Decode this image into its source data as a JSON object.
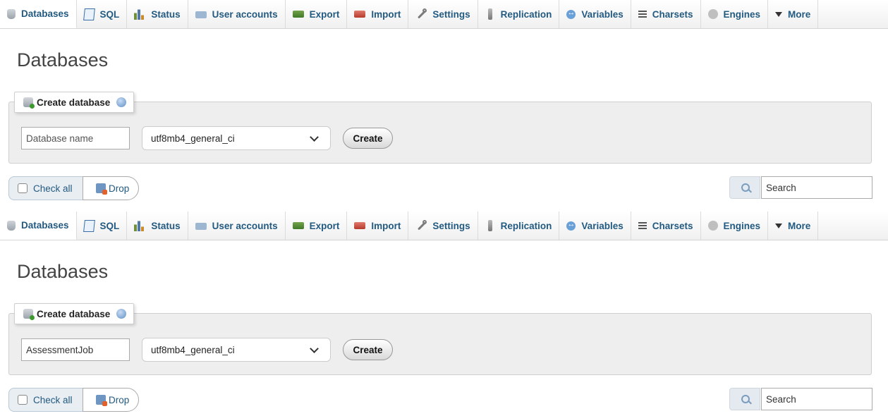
{
  "tabs": [
    {
      "label": "Databases",
      "icon": "database-icon"
    },
    {
      "label": "SQL",
      "icon": "sql-icon"
    },
    {
      "label": "Status",
      "icon": "status-chart-icon"
    },
    {
      "label": "User accounts",
      "icon": "user-accounts-icon"
    },
    {
      "label": "Export",
      "icon": "export-icon"
    },
    {
      "label": "Import",
      "icon": "import-icon"
    },
    {
      "label": "Settings",
      "icon": "wrench-icon"
    },
    {
      "label": "Replication",
      "icon": "replication-icon"
    },
    {
      "label": "Variables",
      "icon": "variables-icon"
    },
    {
      "label": "Charsets",
      "icon": "charsets-icon"
    },
    {
      "label": "Engines",
      "icon": "engines-icon"
    },
    {
      "label": "More",
      "icon": "triangle-down-icon"
    }
  ],
  "panels": [
    {
      "page_title": "Databases",
      "create": {
        "legend": "Create database",
        "db_name_value": "",
        "db_name_placeholder": "Database name",
        "collation": "utf8mb4_general_ci",
        "create_label": "Create"
      },
      "bulk": {
        "check_all_label": "Check all",
        "drop_label": "Drop"
      },
      "search": {
        "placeholder": "Search"
      }
    },
    {
      "page_title": "Databases",
      "create": {
        "legend": "Create database",
        "db_name_value": "AssessmentJob",
        "db_name_placeholder": "Database name",
        "collation": "utf8mb4_general_ci",
        "create_label": "Create"
      },
      "bulk": {
        "check_all_label": "Check all",
        "drop_label": "Drop"
      },
      "search": {
        "placeholder": "Search"
      }
    }
  ],
  "colors": {
    "link": "#235a81",
    "fieldset_bg": "#eeeeee"
  }
}
